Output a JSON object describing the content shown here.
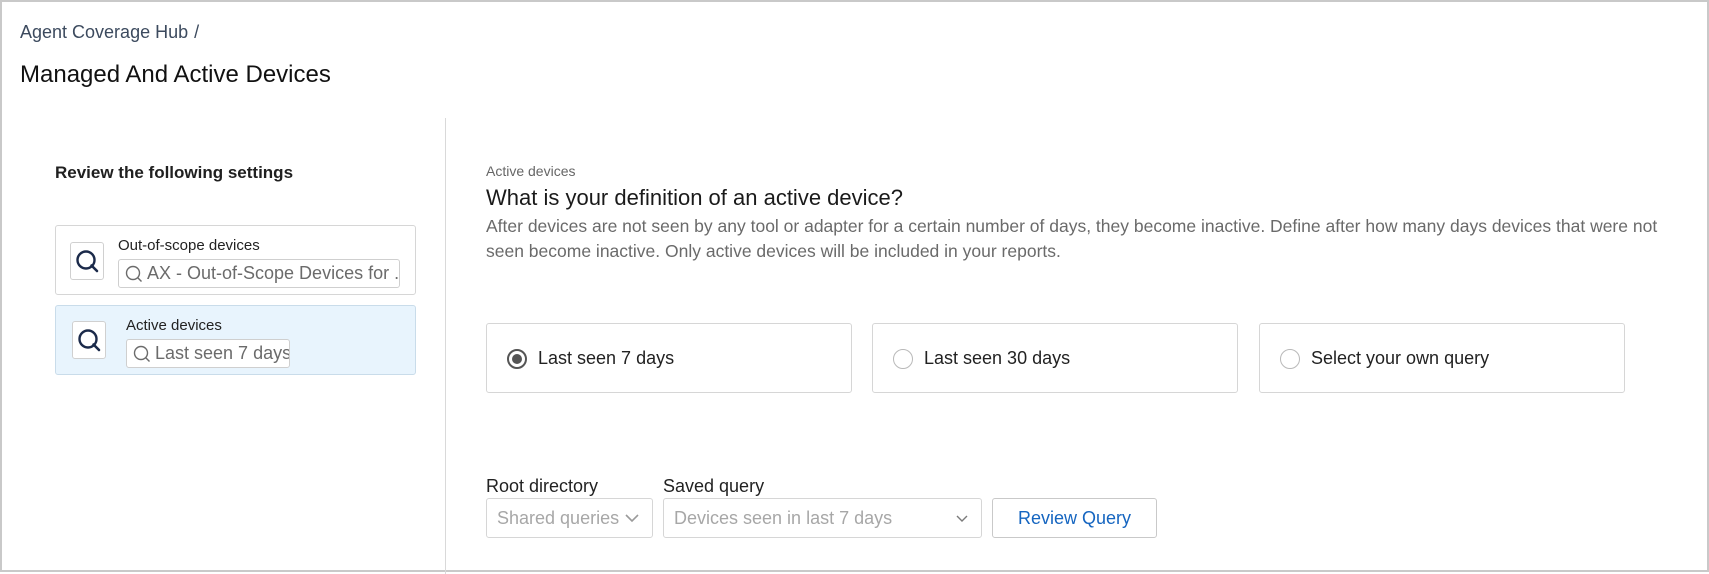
{
  "breadcrumb": {
    "parent": "Agent Coverage Hub",
    "separator": "/"
  },
  "page": {
    "title": "Managed And Active Devices"
  },
  "sidebar": {
    "title": "Review the following settings",
    "cards": [
      {
        "label": "Out-of-scope devices",
        "icon": "query-icon",
        "chip": "AX - Out-of-Scope Devices for ...",
        "selected": false
      },
      {
        "label": "Active devices",
        "icon": "query-icon",
        "chip": "Last seen 7 days",
        "selected": true
      }
    ]
  },
  "main": {
    "eyebrow": "Active devices",
    "title": "What is your definition of an active device?",
    "description": "After devices are not seen by any tool or adapter for a certain number of days, they become inactive. Define after how many days devices that were not seen become inactive. Only active devices will be included in your reports.",
    "options": [
      {
        "label": "Last seen 7 days",
        "checked": true
      },
      {
        "label": "Last seen 30 days",
        "checked": false
      },
      {
        "label": "Select your own query",
        "checked": false
      }
    ],
    "root_directory": {
      "label": "Root directory",
      "value": "Shared queries"
    },
    "saved_query": {
      "label": "Saved query",
      "value": "Devices seen in last 7 days"
    },
    "review_button": "Review Query"
  },
  "colors": {
    "accent": "#1565c0",
    "selected_bg": "#e8f4fd",
    "icon": "#1b2a4a"
  }
}
